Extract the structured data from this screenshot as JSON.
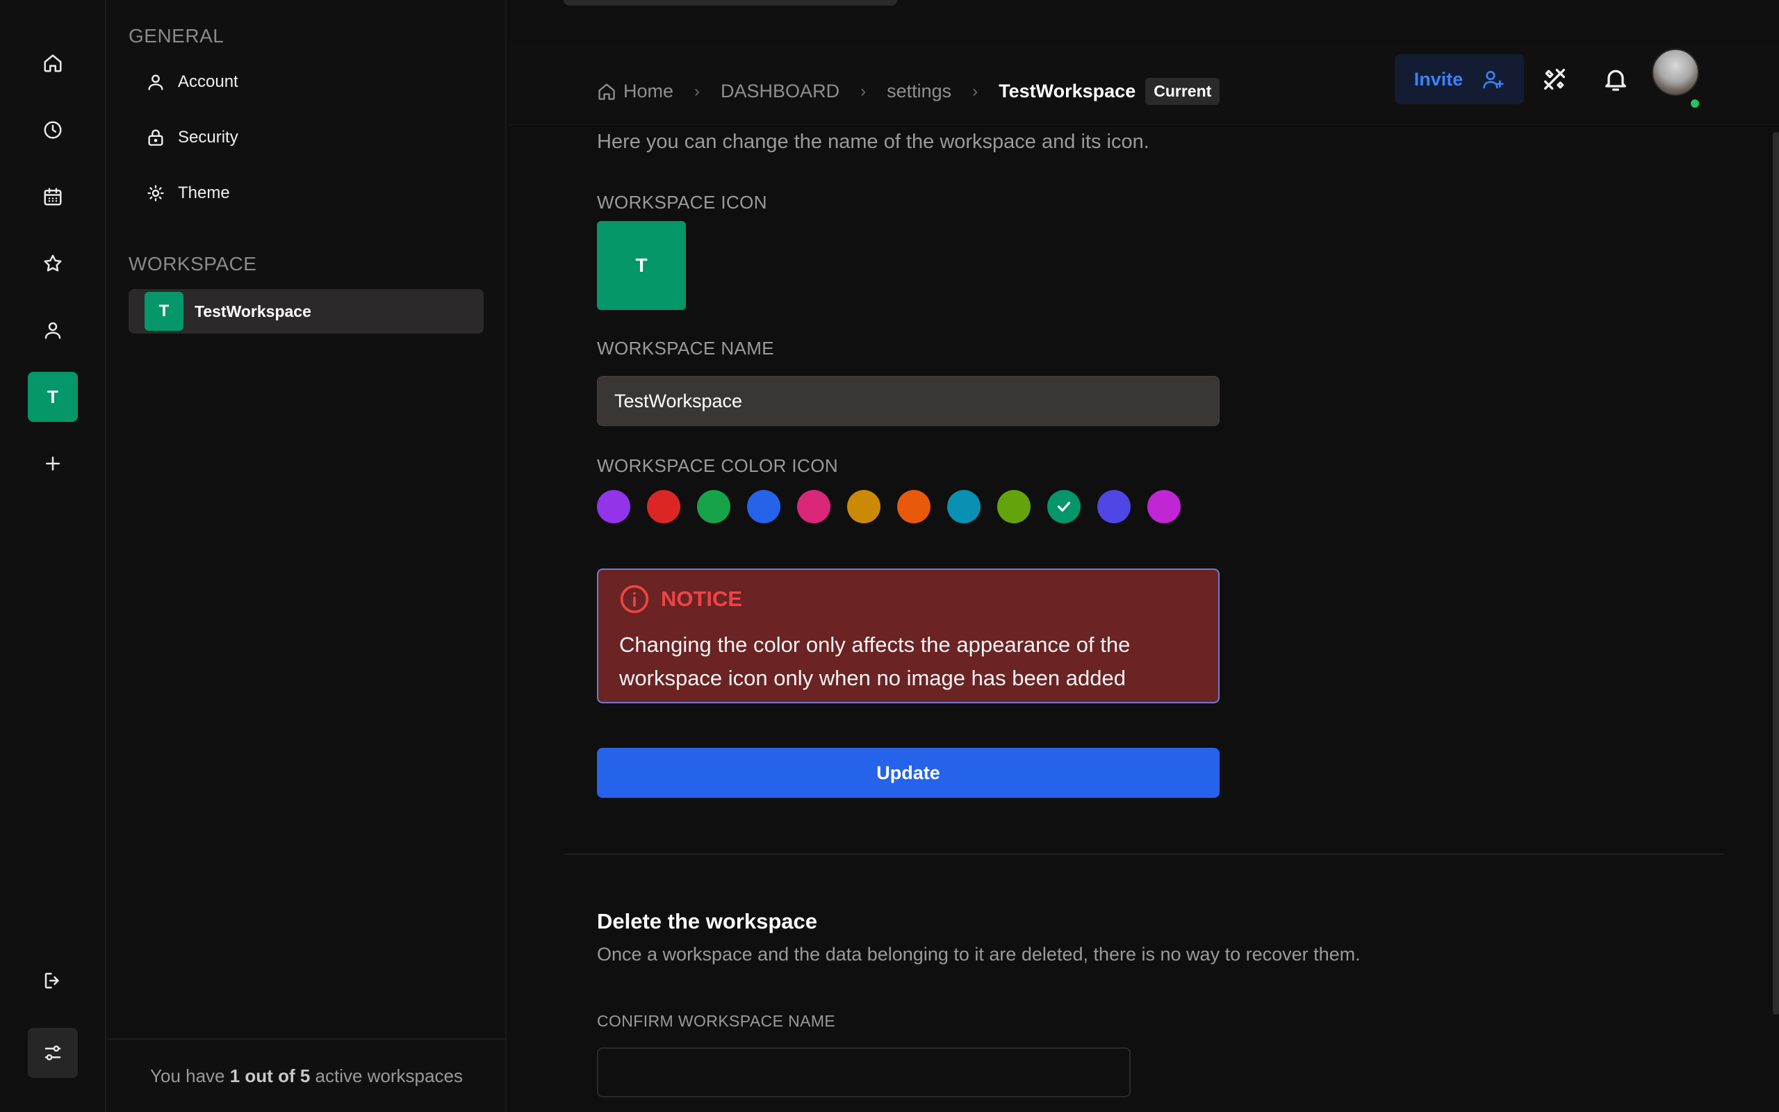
{
  "rail": {
    "items": [
      "home",
      "history",
      "calendar",
      "favorites",
      "profile",
      "workspace",
      "add"
    ],
    "workspace_initial": "T"
  },
  "sidebar": {
    "general_heading": "GENERAL",
    "items": [
      {
        "label": "Account",
        "icon": "user-icon"
      },
      {
        "label": "Security",
        "icon": "lock-icon"
      },
      {
        "label": "Theme",
        "icon": "sun-icon"
      }
    ],
    "workspace_heading": "WORKSPACE",
    "workspace": {
      "initial": "T",
      "name": "TestWorkspace"
    },
    "footer": {
      "prefix": "You have ",
      "bold": "1 out of 5",
      "suffix": " active workspaces"
    }
  },
  "header": {
    "breadcrumbs": [
      "Home",
      "DASHBOARD",
      "settings"
    ],
    "current": "TestWorkspace",
    "current_badge": "Current",
    "invite_label": "Invite",
    "online": true
  },
  "form": {
    "subtitle": "Here you can change the name of the workspace and its icon.",
    "icon_label": "WORKSPACE ICON",
    "icon_initial": "T",
    "name_label": "WORKSPACE NAME",
    "name_value": "TestWorkspace",
    "color_label": "WORKSPACE COLOR ICON",
    "colors": [
      "#9333ea",
      "#dc2626",
      "#16a34a",
      "#2563eb",
      "#db2777",
      "#ca8a04",
      "#ea580c",
      "#0891b2",
      "#65a30d",
      "#059669",
      "#4f46e5",
      "#c026d3"
    ],
    "selected_color_index": 9,
    "notice_title": "NOTICE",
    "notice_text": "Changing the color only affects the appearance of the workspace icon only when no image has been added",
    "update_label": "Update"
  },
  "delete": {
    "title": "Delete the workspace",
    "description": "Once a workspace and the data belonging to it are deleted, there is no way to recover them.",
    "confirm_label": "CONFIRM WORKSPACE NAME",
    "confirm_value": ""
  },
  "colors": {
    "accent": "#2563eb",
    "workspace": "#059669",
    "notice_bg": "#6b2323",
    "notice_title": "#ef4444"
  }
}
